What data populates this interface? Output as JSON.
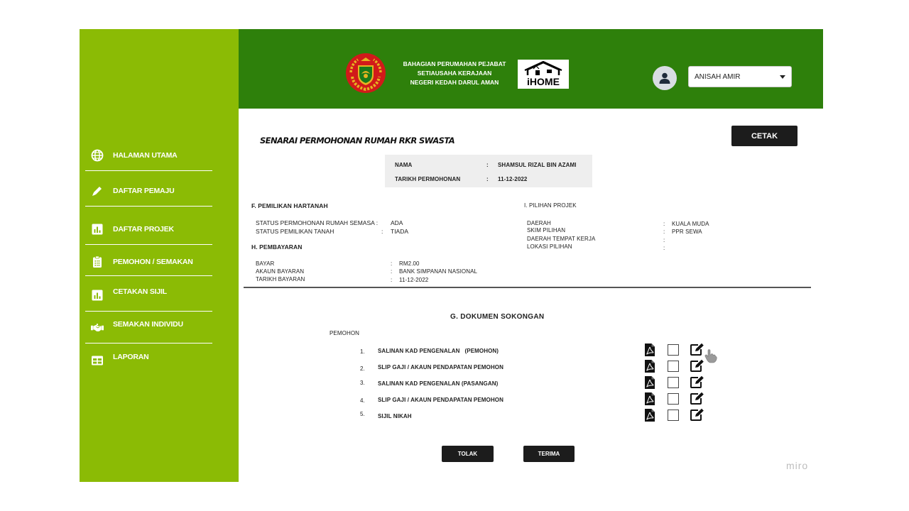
{
  "sidebar": {
    "items": [
      {
        "label": "HALAMAN UTAMA",
        "icon": "globe-icon"
      },
      {
        "label": "DAFTAR PEMAJU",
        "icon": "pen-icon"
      },
      {
        "label": "DAFTAR PROJEK",
        "icon": "bar-chart-icon"
      },
      {
        "label": "PEMOHON / SEMAKAN",
        "icon": "clipboard-icon"
      },
      {
        "label": "CETAKAN SIJIL",
        "icon": "bar-chart-icon"
      },
      {
        "label": "SEMAKAN INDIVIDU",
        "icon": "handshake-icon"
      },
      {
        "label": "LAPORAN",
        "icon": "table-icon"
      }
    ]
  },
  "header": {
    "org_lines": [
      "BAHAGIAN PERUMAHAN PEJABAT",
      "SETIAUSAHA KERAJAAN",
      "NEGERI KEDAH DARUL AMAN"
    ],
    "app_logo_text": "iHOME",
    "user_name": "ANISAH AMIR"
  },
  "page": {
    "title": "SENARAI PERMOHONAN RUMAH RKR SWASTA",
    "print_label": "CETAK"
  },
  "summary": {
    "name_label": "NAMA",
    "name_value": "SHAMSUL RIZAL BIN AZAMI",
    "date_label": "TARIKH PERMOHONAN",
    "date_value": "11-12-2022",
    "sep": ":"
  },
  "sections": {
    "f_title": "F. PEMILIKAN HARTANAH",
    "f_rows": [
      {
        "label": "STATUS PERMOHONAN RUMAH SEMASA :",
        "value": "ADA"
      },
      {
        "label": "STATUS PEMILIKAN TANAH",
        "sep": ":",
        "value": "TIADA"
      }
    ],
    "h_title": "H. PEMBAYARAN",
    "h_rows": [
      {
        "label": "BAYAR",
        "value": "RM2.00"
      },
      {
        "label": "AKAUN BAYARAN",
        "value": "BANK SIMPANAN NASIONAL"
      },
      {
        "label": "TARIKH BAYARAN",
        "value": "11-12-2022"
      }
    ],
    "i_title": "I. PILIHAN PROJEK",
    "i_rows": [
      {
        "label": "DAERAH",
        "value": "KUALA MUDA"
      },
      {
        "label": "SKIM PILIHAN",
        "value": "PPR SEWA"
      },
      {
        "label": "DAERAH TEMPAT KERJA",
        "value": ""
      },
      {
        "label": "LOKASI PILIHAN",
        "value": ""
      }
    ],
    "sep": ":"
  },
  "documents": {
    "title": "G. DOKUMEN SOKONGAN",
    "group_label": "PEMOHON",
    "items": [
      {
        "num": "1.",
        "name": "SALINAN KAD PENGENALAN   (PEMOHON)"
      },
      {
        "num": "2.",
        "name": "SLIP GAJI / AKAUN PENDAPATAN PEMOHON"
      },
      {
        "num": "3.",
        "name": "SALINAN KAD PENGENALAN (PASANGAN)"
      },
      {
        "num": "4.",
        "name": "SLIP GAJI / AKAUN PENDAPATAN PEMOHON"
      },
      {
        "num": "5.",
        "name": "SIJIL NIKAH"
      }
    ]
  },
  "actions": {
    "reject_label": "TOLAK",
    "accept_label": "TERIMA"
  },
  "watermark": "miro",
  "colors": {
    "sidebar": "#8bbb05",
    "header": "#2e800b",
    "button": "#1c1c1c"
  }
}
